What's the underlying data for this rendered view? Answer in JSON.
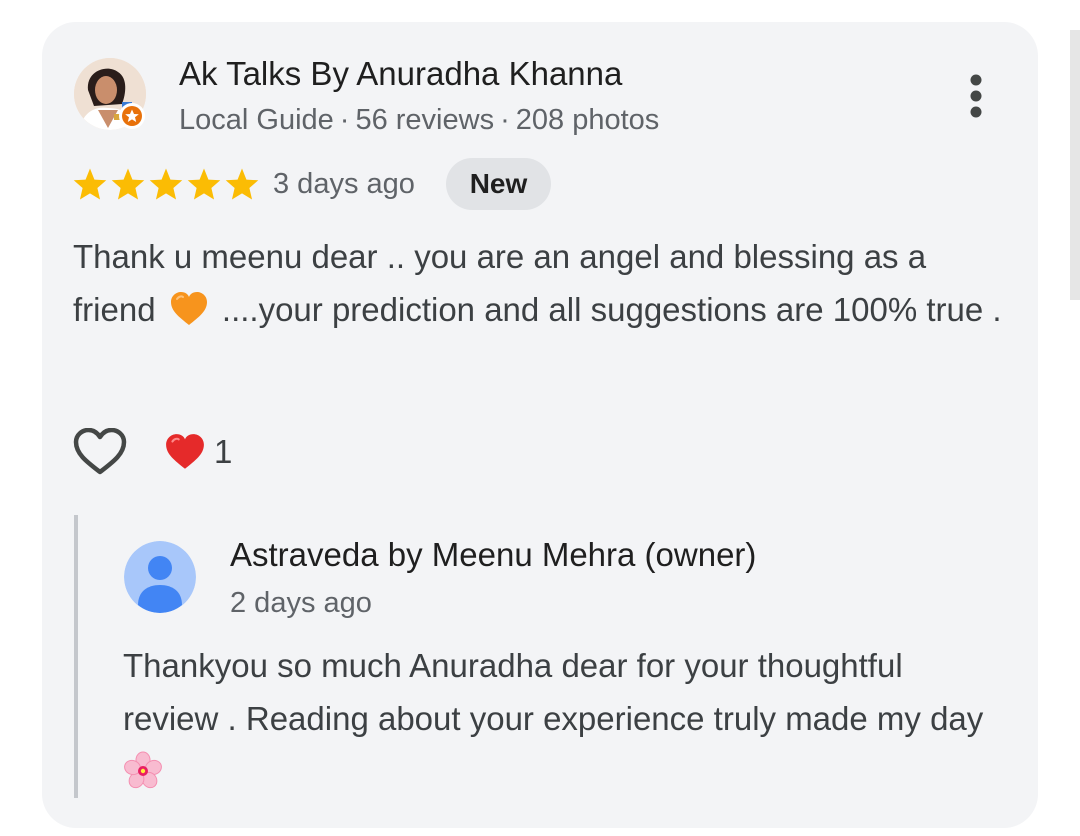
{
  "review": {
    "author": {
      "name": "Ak Talks By Anuradha Khanna",
      "badge": "Local Guide",
      "reviews": "56 reviews",
      "photos": "208 photos",
      "separator": "·"
    },
    "rating": 5,
    "date": "3 days ago",
    "badge": "New",
    "text_part1": "Thank u meenu dear .. you are an angel and blessing as a friend",
    "text_emoji": "orange-heart",
    "text_part2": "....your prediction and all suggestions are 100% true .",
    "reactions": {
      "emoji": "red-heart",
      "count": "1"
    }
  },
  "owner_reply": {
    "name": "Astraveda by Meenu Mehra (owner)",
    "date": "2 days ago",
    "text": "Thankyou so much Anuradha dear for your thoughtful review . Reading about your experience truly made my day",
    "text_emoji": "cherry-blossom"
  },
  "colors": {
    "card_bg": "#f3f4f6",
    "star": "#fbbc04",
    "secondary_text": "#5f6368",
    "badge_bg": "#e1e3e6",
    "owner_avatar": "#4285f4"
  },
  "icons": {
    "more": "more-vert-icon",
    "like": "heart-outline-icon",
    "local_guide": "local-guide-star-icon"
  }
}
